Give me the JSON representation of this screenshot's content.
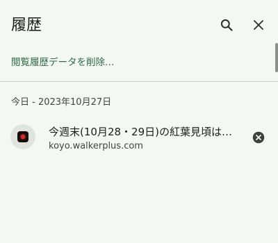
{
  "header": {
    "title": "履歴",
    "search_icon": "search-icon",
    "close_icon": "close-icon"
  },
  "clear_browsing_data": {
    "label": "閲覧履歴データを削除…"
  },
  "history": {
    "groups": [
      {
        "date_label": "今日 - 2023年10月27日",
        "items": [
          {
            "title": "今週末(10月28・29日)の紅葉見頃は…",
            "domain": "koyo.walkerplus.com",
            "favicon": "maple-leaf-icon",
            "remove_icon": "remove-icon"
          }
        ]
      }
    ]
  },
  "colors": {
    "background": "#f4f8f2",
    "link_accent": "#2f6b45",
    "favicon_leaf": "#d4302a"
  }
}
